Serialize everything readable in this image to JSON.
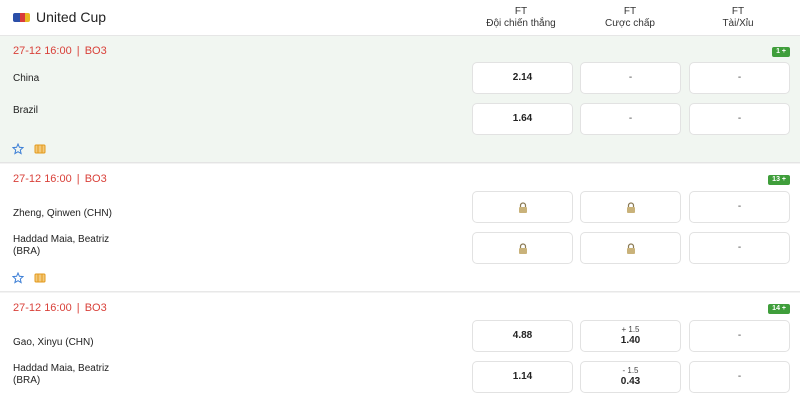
{
  "header": {
    "league_title": "United Cup",
    "columns": [
      {
        "ft": "FT",
        "label": "Đội chiến thắng"
      },
      {
        "ft": "FT",
        "label": "Cược chấp"
      },
      {
        "ft": "FT",
        "label": "Tài/Xỉu"
      }
    ]
  },
  "matches": [
    {
      "date": "27-12 16:00",
      "format": "BO3",
      "more_markets": "1 +",
      "team1": "China",
      "team2": "Brazil",
      "team2_line2": "",
      "odds": [
        {
          "win": "2.14",
          "handicap": "-",
          "total": "-"
        },
        {
          "win": "1.64",
          "handicap": "-",
          "total": "-"
        }
      ]
    },
    {
      "date": "27-12 16:00",
      "format": "BO3",
      "more_markets": "13 +",
      "team1": "Zheng, Qinwen (CHN)",
      "team2": "Haddad Maia, Beatriz",
      "team2_line2": "(BRA)",
      "odds": [
        {
          "win": "locked",
          "handicap": "locked",
          "total": "-"
        },
        {
          "win": "locked",
          "handicap": "locked",
          "total": "-"
        }
      ]
    },
    {
      "date": "27-12 16:00",
      "format": "BO3",
      "more_markets": "14 +",
      "team1": "Gao, Xinyu (CHN)",
      "team2": "Haddad Maia, Beatriz",
      "team2_line2": "(BRA)",
      "odds": [
        {
          "win": "4.88",
          "handicap_line": "+ 1.5",
          "handicap": "1.40",
          "total": "-"
        },
        {
          "win": "1.14",
          "handicap_line": "- 1.5",
          "handicap": "0.43",
          "total": "-"
        }
      ]
    }
  ],
  "separator": "|",
  "icons": {
    "league_logo": "united-cup-logo",
    "favorite": "star-icon",
    "stats": "ticket-icon",
    "locked": "lock-icon"
  },
  "colors": {
    "time_red": "#d9413a",
    "badge_green": "#3f9e3b",
    "highlight_row": "#f1f6f1"
  }
}
